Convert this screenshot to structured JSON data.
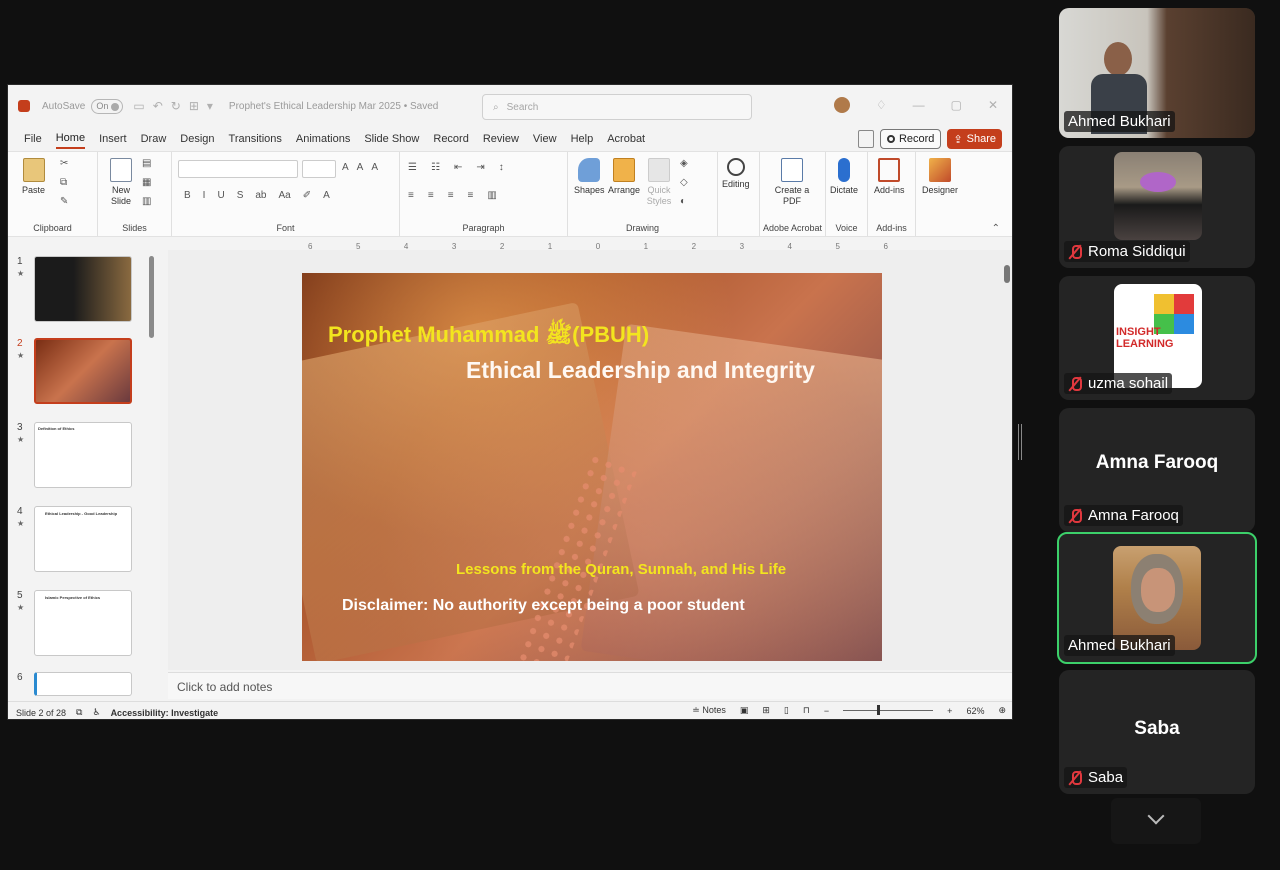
{
  "titlebar": {
    "autosave_label": "AutoSave",
    "autosave_state": "On",
    "document_title": "Prophet's Ethical Leadership Mar 2025 • Saved",
    "search_placeholder": "Search"
  },
  "menu": {
    "tabs": [
      "File",
      "Home",
      "Insert",
      "Draw",
      "Design",
      "Transitions",
      "Animations",
      "Slide Show",
      "Record",
      "Review",
      "View",
      "Help",
      "Acrobat"
    ],
    "active_tab": "Home",
    "record_label": "Record",
    "share_label": "Share"
  },
  "ribbon": {
    "groups": {
      "clipboard": "Clipboard",
      "slides": "Slides",
      "font": "Font",
      "paragraph": "Paragraph",
      "drawing": "Drawing",
      "adobe_acrobat": "Adobe Acrobat",
      "voice": "Voice",
      "addins": "Add-ins"
    },
    "buttons": {
      "paste": "Paste",
      "new_slide": "New Slide",
      "shapes": "Shapes",
      "arrange": "Arrange",
      "quick_styles": "Quick Styles",
      "editing": "Editing",
      "create_pdf": "Create a PDF",
      "dictate": "Dictate",
      "addins": "Add-ins",
      "designer": "Designer"
    }
  },
  "ruler_ticks": [
    "6",
    "5",
    "4",
    "3",
    "2",
    "1",
    "0",
    "1",
    "2",
    "3",
    "4",
    "5",
    "6"
  ],
  "slides_panel": {
    "thumbnails": [
      {
        "num": "1",
        "title": ""
      },
      {
        "num": "2",
        "title": ""
      },
      {
        "num": "3",
        "title": "Definition of Ethics"
      },
      {
        "num": "4",
        "title": "Ethical Leadership - Good Leadership"
      },
      {
        "num": "5",
        "title": "Islamic Perspective of Ethics"
      },
      {
        "num": "6",
        "title": ""
      }
    ],
    "active_index": 2
  },
  "slide": {
    "title_line1": "Prophet Muhammad ﷺ(PBUH)",
    "title_line2": "Ethical Leadership and Integrity",
    "subtitle": "Lessons from the Quran, Sunnah, and His Life",
    "disclaimer": "Disclaimer: No authority except being a poor student"
  },
  "notes_placeholder": "Click to add notes",
  "statusbar": {
    "slide_counter": "Slide 2 of 28",
    "accessibility": "Accessibility: Investigate",
    "notes_label": "Notes",
    "zoom": "62%"
  },
  "participants": [
    {
      "name": "Ahmed Bukhari",
      "muted": false,
      "video": true,
      "active": false
    },
    {
      "name": "Roma  Siddiqui",
      "muted": true,
      "video": true,
      "active": false
    },
    {
      "name": "uzma sohail",
      "muted": true,
      "video": true,
      "active": false,
      "logo_text": "INSIGHT LEARNING"
    },
    {
      "name": "Amna Farooq",
      "muted": true,
      "video": false,
      "active": false
    },
    {
      "name": "Ahmed Bukhari",
      "muted": false,
      "video": true,
      "active": true
    },
    {
      "name": "Saba",
      "muted": true,
      "video": false,
      "active": false
    }
  ],
  "colors": {
    "ppt_accent": "#c43e1c",
    "active_speaker": "#3cd06a",
    "slide_title_yellow": "#f3e51e"
  }
}
